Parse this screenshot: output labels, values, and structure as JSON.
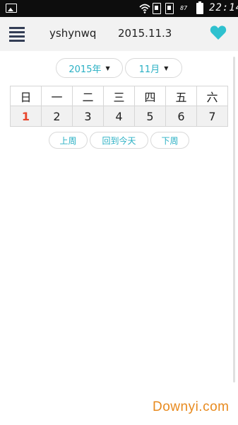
{
  "status_bar": {
    "battery_percent": "87",
    "time": "22:14"
  },
  "header": {
    "username": "yshynwq",
    "date": "2015.11.3",
    "accent_color": "#2fc1cf"
  },
  "selectors": {
    "year": "2015年",
    "month": "11月"
  },
  "week": {
    "weekday_headers": [
      "日",
      "一",
      "二",
      "三",
      "四",
      "五",
      "六"
    ],
    "days": [
      "1",
      "2",
      "3",
      "4",
      "5",
      "6",
      "7"
    ],
    "selected_day": "3"
  },
  "nav": {
    "prev_week": "上周",
    "back_to_today": "回到今天",
    "next_week": "下周"
  },
  "watermark": "Downyi.com"
}
